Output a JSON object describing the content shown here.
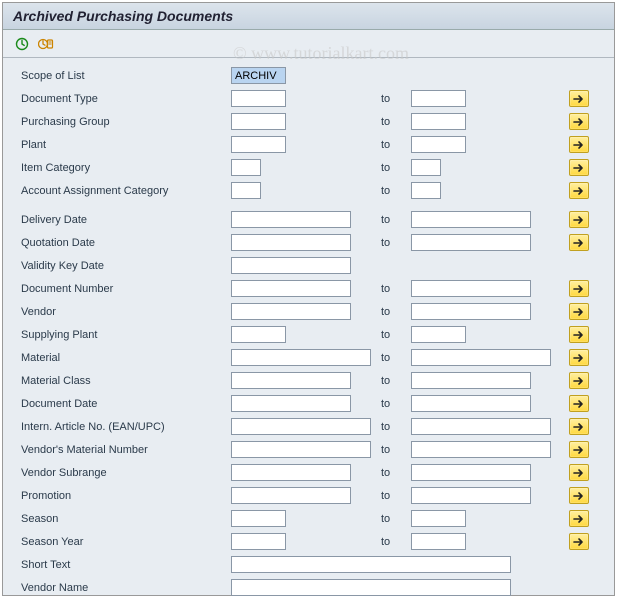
{
  "title": "Archived Purchasing Documents",
  "watermark": "© www.tutorialkart.com",
  "toolbar": {
    "execute_icon": "execute",
    "variant_icon": "variant"
  },
  "to_label": "to",
  "scope_of_list": {
    "label": "Scope of List",
    "value": "ARCHIV"
  },
  "rows": {
    "document_type": {
      "label": "Document Type",
      "from": "",
      "to": "",
      "from_w": "w-sm",
      "to_w": "w-sm",
      "multi": true
    },
    "purchasing_group": {
      "label": "Purchasing Group",
      "from": "",
      "to": "",
      "from_w": "w-sm",
      "to_w": "w-sm",
      "multi": true
    },
    "plant": {
      "label": "Plant",
      "from": "",
      "to": "",
      "from_w": "w-sm",
      "to_w": "w-sm",
      "multi": true
    },
    "item_category": {
      "label": "Item Category",
      "from": "",
      "to": "",
      "from_w": "w-xs",
      "to_w": "w-xs",
      "multi": true
    },
    "acct_assign_cat": {
      "label": "Account Assignment Category",
      "from": "",
      "to": "",
      "from_w": "w-xs",
      "to_w": "w-xs",
      "multi": true
    },
    "delivery_date": {
      "label": "Delivery Date",
      "from": "",
      "to": "",
      "from_w": "w-md",
      "to_w": "w-md",
      "multi": true
    },
    "quotation_date": {
      "label": "Quotation Date",
      "from": "",
      "to": "",
      "from_w": "w-md",
      "to_w": "w-md",
      "multi": true
    },
    "validity_key_date": {
      "label": "Validity Key Date",
      "value": ""
    },
    "document_number": {
      "label": "Document Number",
      "from": "",
      "to": "",
      "from_w": "w-md",
      "to_w": "w-md",
      "multi": true
    },
    "vendor": {
      "label": "Vendor",
      "from": "",
      "to": "",
      "from_w": "w-md",
      "to_w": "w-md",
      "multi": true
    },
    "supplying_plant": {
      "label": "Supplying Plant",
      "from": "",
      "to": "",
      "from_w": "w-sm",
      "to_w": "w-sm",
      "multi": true
    },
    "material": {
      "label": "Material",
      "from": "",
      "to": "",
      "from_w": "w-lg",
      "to_w": "w-lg",
      "multi": true
    },
    "material_class": {
      "label": "Material Class",
      "from": "",
      "to": "",
      "from_w": "w-md",
      "to_w": "w-md",
      "multi": true
    },
    "document_date": {
      "label": "Document Date",
      "from": "",
      "to": "",
      "from_w": "w-md",
      "to_w": "w-md",
      "multi": true
    },
    "ean_upc": {
      "label": "Intern. Article No. (EAN/UPC)",
      "from": "",
      "to": "",
      "from_w": "w-lg",
      "to_w": "w-lg",
      "multi": true
    },
    "vendor_mat_no": {
      "label": "Vendor's Material Number",
      "from": "",
      "to": "",
      "from_w": "w-lg",
      "to_w": "w-lg",
      "multi": true
    },
    "vendor_subrange": {
      "label": "Vendor Subrange",
      "from": "",
      "to": "",
      "from_w": "w-md",
      "to_w": "w-md",
      "multi": true
    },
    "promotion": {
      "label": "Promotion",
      "from": "",
      "to": "",
      "from_w": "w-md",
      "to_w": "w-md",
      "multi": true
    },
    "season": {
      "label": "Season",
      "from": "",
      "to": "",
      "from_w": "w-sm",
      "to_w": "w-sm",
      "multi": true
    },
    "season_year": {
      "label": "Season Year",
      "from": "",
      "to": "",
      "from_w": "w-sm",
      "to_w": "w-sm",
      "multi": true
    },
    "short_text": {
      "label": "Short Text",
      "value": ""
    },
    "vendor_name": {
      "label": "Vendor Name",
      "value": ""
    }
  }
}
